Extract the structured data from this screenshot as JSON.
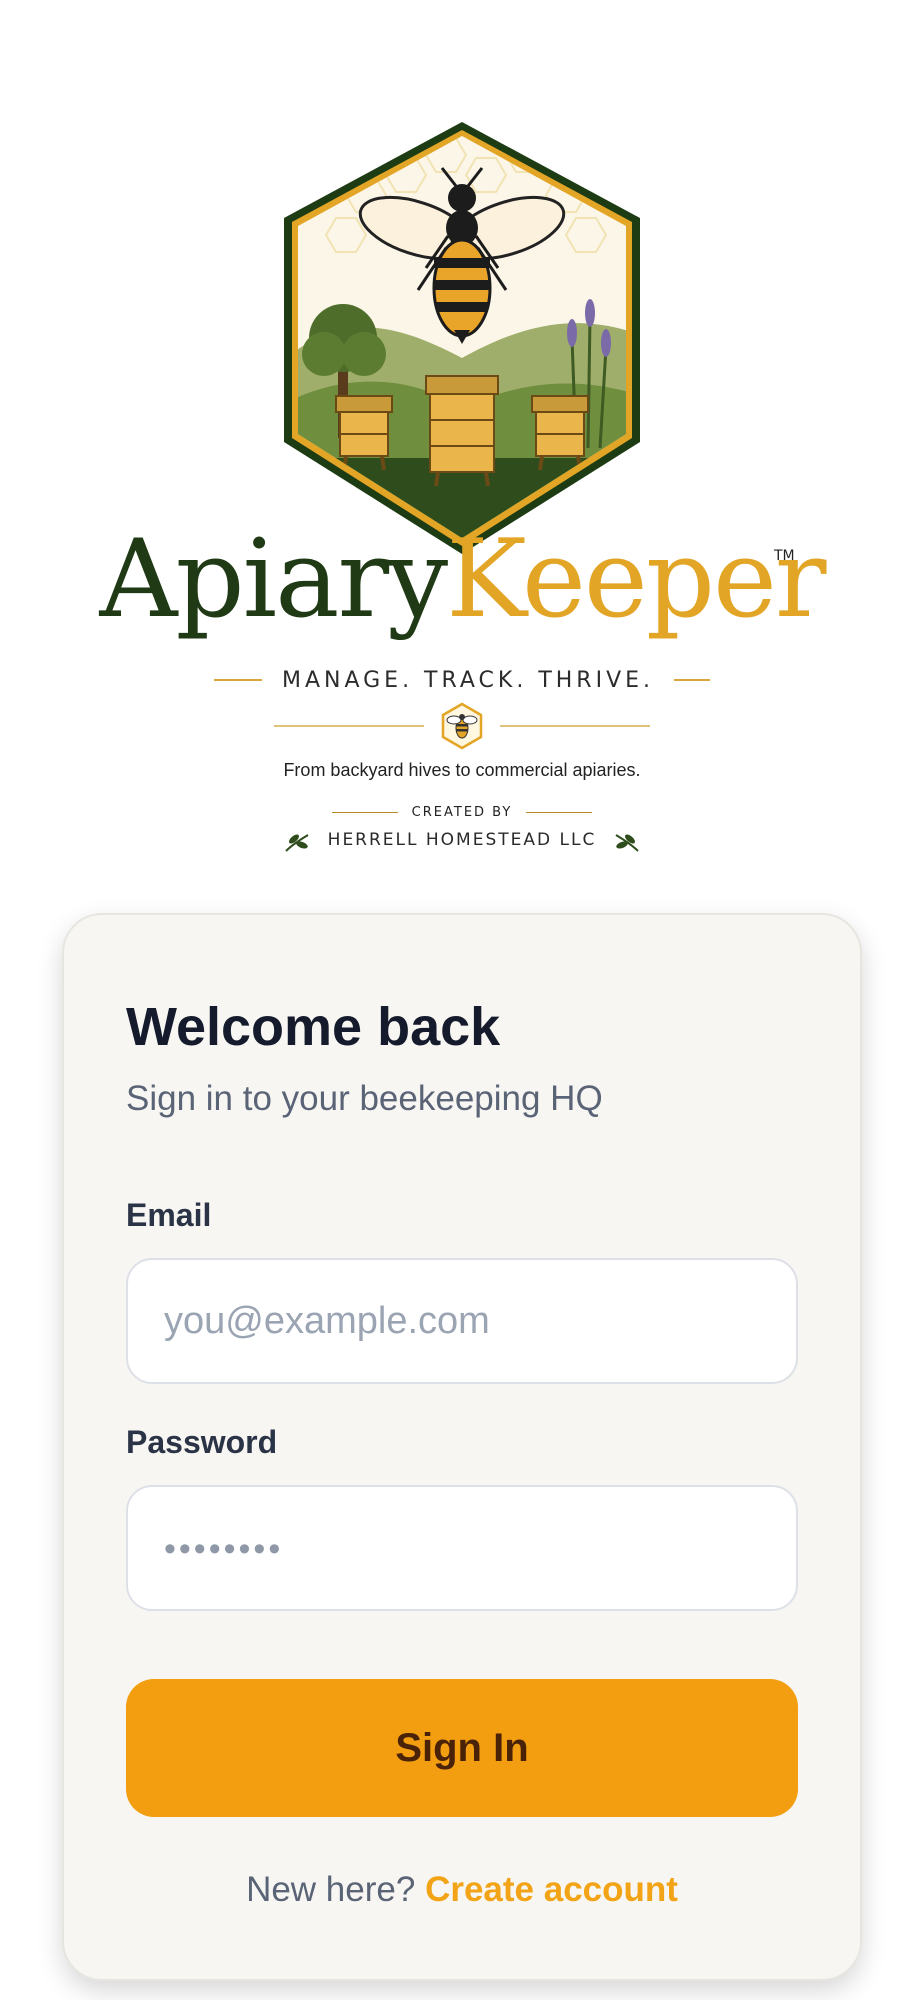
{
  "branding": {
    "wordmark_part1": "Apiary",
    "wordmark_part2": "Keeper",
    "trademark": "TM",
    "tagline": "MANAGE. TRACK. THRIVE.",
    "subtagline": "From backyard hives to commercial apiaries.",
    "created_by": "CREATED BY",
    "company": "HERRELL HOMESTEAD LLC"
  },
  "login": {
    "title": "Welcome back",
    "subtitle": "Sign in to your beekeeping HQ",
    "email_label": "Email",
    "email_placeholder": "you@example.com",
    "password_label": "Password",
    "password_placeholder": "••••••••",
    "signin_label": "Sign In",
    "footer_prompt": "New here?",
    "footer_link": "Create account"
  },
  "colors": {
    "brand_green": "#1f3a14",
    "brand_gold": "#e2a526",
    "accent_orange": "#f29e10",
    "card_background": "#f7f6f2",
    "heading_text": "#151b2c",
    "muted_text": "#5a6476"
  },
  "icons": {
    "logo": "beehive-logo-emblem",
    "emblem": "bee-hexagon-icon",
    "ornament": "leaf-sprig-icon"
  }
}
